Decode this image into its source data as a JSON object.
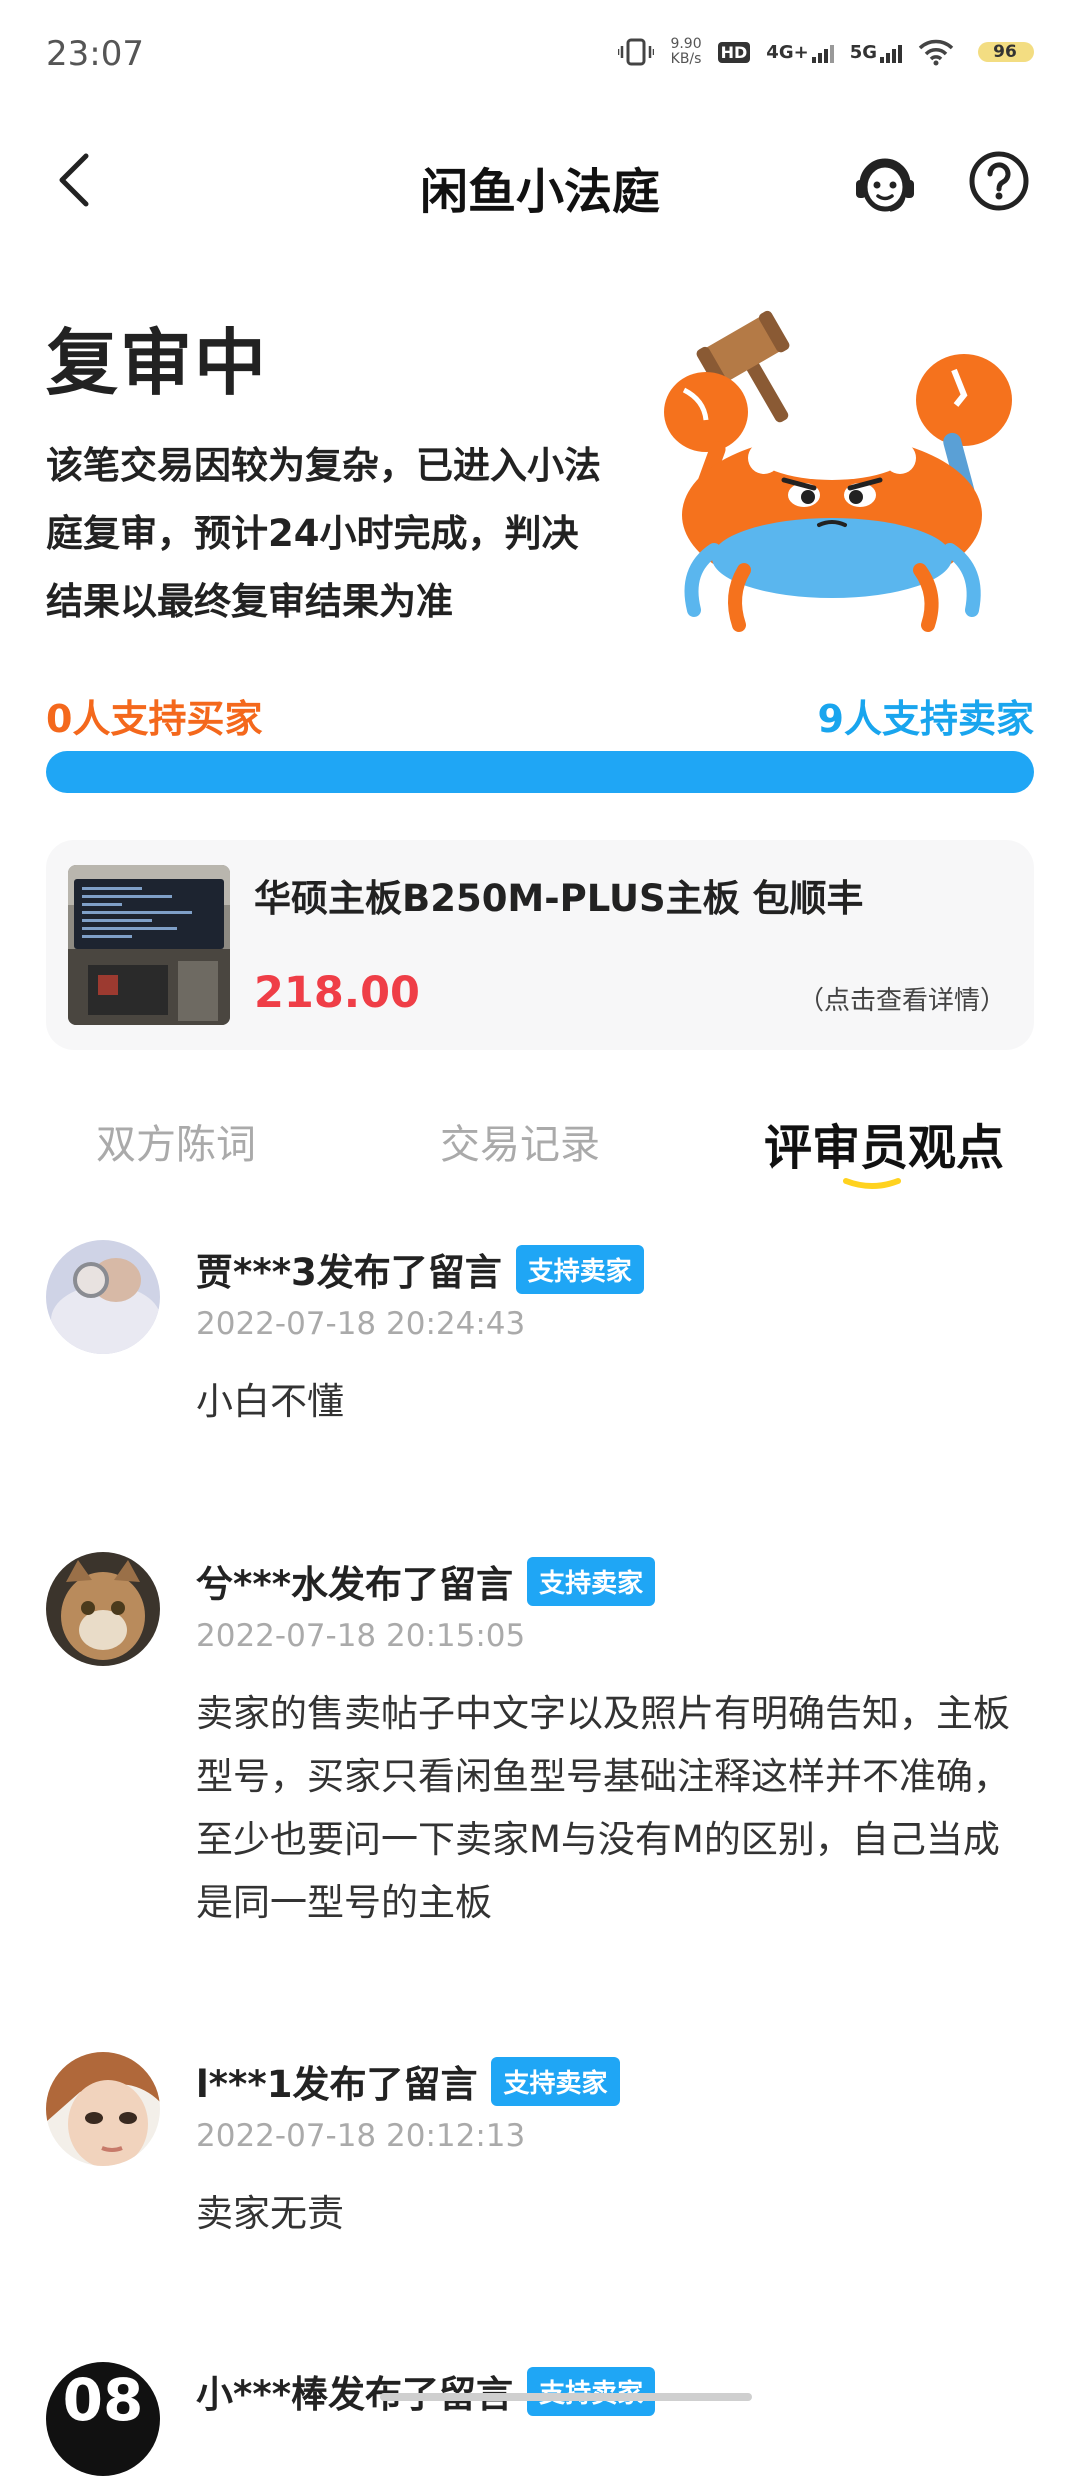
{
  "status_bar": {
    "time": "23:07",
    "speed_value": "9.90",
    "speed_unit": "KB/s",
    "hd_label": "HD",
    "net1": "4G+",
    "net2": "5G",
    "battery": "96"
  },
  "nav": {
    "title": "闲鱼小法庭"
  },
  "hero": {
    "title": "复审中",
    "description": "该笔交易因较为复杂，已进入小法庭复审，预计24小时完成，判决结果以最终复审结果为准"
  },
  "support": {
    "buyer_label": "0人支持买家",
    "seller_label": "9人支持卖家",
    "buyer_count": 0,
    "seller_count": 9,
    "buyer_color": "#f4681c",
    "seller_color": "#1fa6f5"
  },
  "product": {
    "title": "华硕主板B250M-PLUS主板 包顺丰",
    "price": "218.00",
    "detail_link": "（点击查看详情）"
  },
  "tabs": [
    {
      "label": "双方陈词",
      "active": false
    },
    {
      "label": "交易记录",
      "active": false
    },
    {
      "label": "评审员观点",
      "active": true
    }
  ],
  "comments": [
    {
      "name": "贾***3发布了留言",
      "badge": "支持卖家",
      "time": "2022-07-18 20:24:43",
      "text": "小白不懂"
    },
    {
      "name": "兮***水发布了留言",
      "badge": "支持卖家",
      "time": "2022-07-18 20:15:05",
      "text": "卖家的售卖帖子中文字以及照片有明确告知，主板型号，买家只看闲鱼型号基础注释这样并不准确，至少也要问一下卖家M与没有M的区别，自己当成是同一型号的主板"
    },
    {
      "name": "l***1发布了留言",
      "badge": "支持卖家",
      "time": "2022-07-18 20:12:13",
      "text": "卖家无责"
    },
    {
      "name": "小***棒发布了留言",
      "badge": "支持卖家",
      "avatar_text": "08"
    }
  ]
}
